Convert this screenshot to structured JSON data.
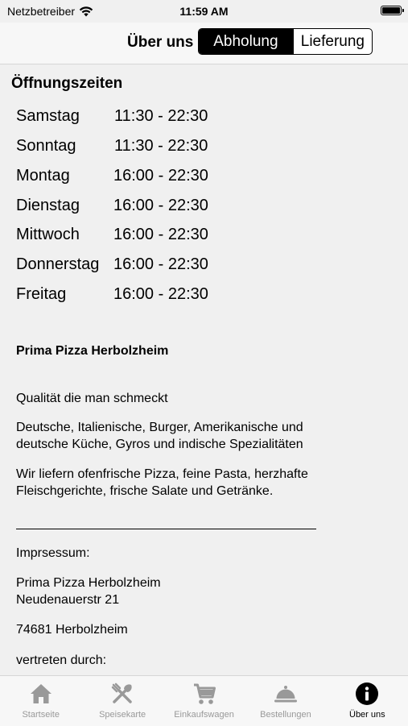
{
  "status_bar": {
    "carrier": "Netzbetreiber",
    "time": "11:59 AM"
  },
  "nav": {
    "title": "Über uns",
    "segments": [
      {
        "label": "Abholung",
        "selected": true
      },
      {
        "label": "Lieferung",
        "selected": false
      }
    ]
  },
  "hours": {
    "title": "Öffnungszeiten",
    "rows": [
      {
        "day": "Samstag",
        "time": "11:30 - 22:30"
      },
      {
        "day": "Sonntag",
        "time": "11:30 - 22:30"
      },
      {
        "day": "Montag",
        "time": "16:00 - 22:30"
      },
      {
        "day": "Dienstag",
        "time": "16:00 - 22:30"
      },
      {
        "day": "Mittwoch",
        "time": "16:00 - 22:30"
      },
      {
        "day": "Donnerstag",
        "time": "16:00 - 22:30"
      },
      {
        "day": "Freitag",
        "time": "16:00 - 22:30"
      }
    ]
  },
  "about": {
    "name": "Prima Pizza Herbolzheim",
    "slogan": "Qualität die man schmeckt",
    "cuisine": "Deutsche, Italienische, Burger, Amerikanische und deutsche Küche, Gyros und indische Spezialitäten",
    "delivery": "Wir liefern ofenfrische Pizza, feine Pasta, herzhafte Fleischgerichte, frische Salate und Getränke."
  },
  "imprint": {
    "heading": "Imprsessum:",
    "company": "Prima Pizza Herbolzheim",
    "street": "Neudenauerstr 21",
    "city": "74681 Herbolzheim",
    "represented": "vertreten durch:"
  },
  "tabs": [
    {
      "label": "Startseite",
      "icon": "home-icon",
      "active": false
    },
    {
      "label": "Speisekarte",
      "icon": "utensils-icon",
      "active": false
    },
    {
      "label": "Einkaufswagen",
      "icon": "cart-icon",
      "active": false
    },
    {
      "label": "Bestellungen",
      "icon": "cloche-icon",
      "active": false
    },
    {
      "label": "Über uns",
      "icon": "info-icon",
      "active": true
    }
  ]
}
